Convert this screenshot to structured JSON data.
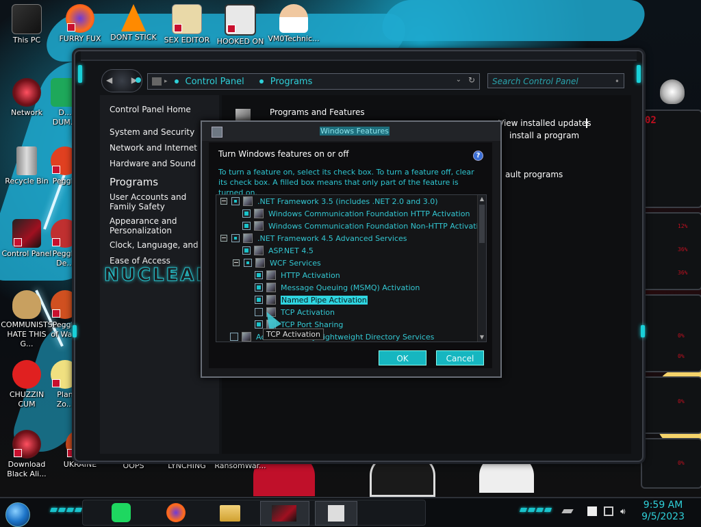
{
  "desktop": {
    "icons": [
      {
        "label": "This PC"
      },
      {
        "label": "FURRY FUX"
      },
      {
        "label": "DONT STICK"
      },
      {
        "label": "SEX EDITOR"
      },
      {
        "label": "HOOKED ON"
      },
      {
        "label": "VM0Technic..."
      },
      {
        "label": "Network"
      },
      {
        "label": "D... DUM..."
      },
      {
        "label": "Recycle Bin"
      },
      {
        "label": "Peggle"
      },
      {
        "label": "Control Panel"
      },
      {
        "label": "Peggle De..."
      },
      {
        "label": "COMMUNISTS HATE THIS G..."
      },
      {
        "label": "Peggle of Wa..."
      },
      {
        "label": "CHUZZIN CUM"
      },
      {
        "label": "Plan Zo..."
      },
      {
        "label": "Download Black Ali..."
      },
      {
        "label": "UKRAINE"
      },
      {
        "label": "OOPS"
      },
      {
        "label": "LYNCHING"
      },
      {
        "label": "RansomWar..."
      }
    ]
  },
  "control_panel": {
    "breadcrumb": [
      "Control Panel",
      "Programs"
    ],
    "search_placeholder": "Search Control Panel",
    "sidebar": {
      "home": "Control Panel Home",
      "links": [
        "System and Security",
        "Network and Internet",
        "Hardware and Sound"
      ],
      "current": "Programs",
      "more_links": [
        "User Accounts and Family Safety",
        "Appearance and Personalization",
        "Clock, Language, and Re",
        "Ease of Access"
      ],
      "brand_text": "NUCLEAI"
    },
    "main": {
      "heading": "Programs and Features",
      "link_updates": "View installed updates",
      "link_install": "install a program",
      "link_default": "ault programs"
    }
  },
  "windows_features": {
    "title": "Windows Features",
    "heading": "Turn Windows features on or off",
    "help": "?",
    "description": "To turn a feature on, select its check box. To turn a feature off, clear its check box. A filled box means that only part of the feature is turned on.",
    "tree": [
      {
        "label": ".NET Framework 3.5 (includes .NET 2.0 and 3.0)",
        "level": 0,
        "expander": true,
        "state": "part"
      },
      {
        "label": "Windows Communication Foundation HTTP Activation",
        "level": 1,
        "expander": false,
        "state": "full"
      },
      {
        "label": "Windows Communication Foundation Non-HTTP Activation",
        "level": 1,
        "expander": false,
        "state": "full"
      },
      {
        "label": ".NET Framework 4.5 Advanced Services",
        "level": 0,
        "expander": true,
        "state": "part"
      },
      {
        "label": "ASP.NET 4.5",
        "level": 1,
        "expander": false,
        "state": "full"
      },
      {
        "label": "WCF Services",
        "level": 1,
        "expander": true,
        "state": "part"
      },
      {
        "label": "HTTP Activation",
        "level": 2,
        "expander": false,
        "state": "full"
      },
      {
        "label": "Message Queuing (MSMQ) Activation",
        "level": 2,
        "expander": false,
        "state": "full"
      },
      {
        "label": "Named Pipe Activation",
        "level": 2,
        "expander": false,
        "state": "full",
        "selected": true
      },
      {
        "label": "TCP Activation",
        "level": 2,
        "expander": false,
        "state": "none"
      },
      {
        "label": "TCP Port Sharing",
        "level": 2,
        "expander": false,
        "state": "full"
      },
      {
        "label": "Active Directory Lightweight Directory Services",
        "level": 0,
        "expander": false,
        "state": "none"
      }
    ],
    "tooltip": "TCP Activation",
    "ok": "OK",
    "cancel": "Cancel"
  },
  "gadget_numbers": [
    "02",
    "12%",
    "36%",
    "36%",
    "0%",
    "0%",
    "0%",
    "0%"
  ],
  "taskbar": {
    "time": "9:59 AM",
    "date": "9/5/2023"
  },
  "colors": {
    "accent": "#19c4cc",
    "link_cyan": "#2fc6d1",
    "wallpaper_blue": "#1ea9cf",
    "gadget_red": "#c21020"
  }
}
